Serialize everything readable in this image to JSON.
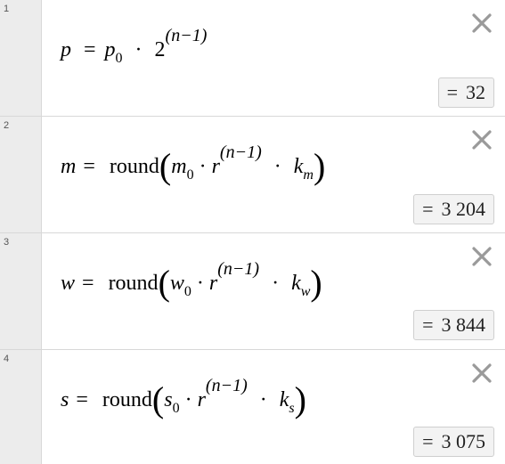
{
  "expressions": [
    {
      "number": "1",
      "result_eq": "=",
      "result_value": "32",
      "formula": {
        "lhs": "p",
        "eq": "=",
        "base": "p",
        "base_sub": "0",
        "dot": "·",
        "two": "2",
        "exponent": "(n−1)"
      }
    },
    {
      "number": "2",
      "result_eq": "=",
      "result_value": "3 204",
      "formula": {
        "lhs": "m",
        "eq": "=",
        "fn": "round",
        "lparen": "(",
        "rparen": ")",
        "var": "m",
        "var_sub": "0",
        "dot": "·",
        "r": "r",
        "exponent": "(n−1)",
        "k": "k",
        "k_sub": "m"
      }
    },
    {
      "number": "3",
      "result_eq": "=",
      "result_value": "3 844",
      "formula": {
        "lhs": "w",
        "eq": "=",
        "fn": "round",
        "lparen": "(",
        "rparen": ")",
        "var": "w",
        "var_sub": "0",
        "dot": "·",
        "r": "r",
        "exponent": "(n−1)",
        "k": "k",
        "k_sub": "w"
      }
    },
    {
      "number": "4",
      "result_eq": "=",
      "result_value": "3 075",
      "formula": {
        "lhs": "s",
        "eq": "=",
        "fn": "round",
        "lparen": "(",
        "rparen": ")",
        "var": "s",
        "var_sub": "0",
        "dot": "·",
        "r": "r",
        "exponent": "(n−1)",
        "k": "k",
        "k_sub": "s"
      }
    }
  ],
  "icons": {
    "delete": "close-x-icon"
  }
}
